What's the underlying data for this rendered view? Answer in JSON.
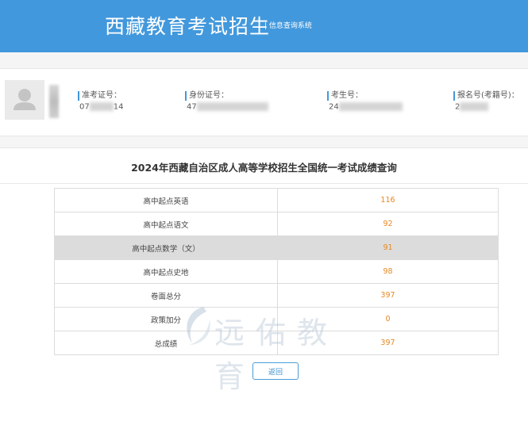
{
  "header": {
    "title": "西藏教育考试招生",
    "subtitle": "| 信息查询系统"
  },
  "candidate": {
    "fields": [
      {
        "label": "准考证号：",
        "value_start": "07",
        "value_end": "14"
      },
      {
        "label": "身份证号：",
        "value_start": "47",
        "value_end": ""
      },
      {
        "label": "考生号：",
        "value_start": "24",
        "value_end": ""
      },
      {
        "label": "报名号(考籍号)：",
        "value_start": "2",
        "value_end": ""
      }
    ]
  },
  "result": {
    "title": "2024年西藏自治区成人高等学校招生全国统一考试成绩查询",
    "rows": [
      {
        "subject": "高中起点英语",
        "score": "116"
      },
      {
        "subject": "高中起点语文",
        "score": "92"
      },
      {
        "subject": "高中起点数学（文）",
        "score": "91"
      },
      {
        "subject": "高中起点史地",
        "score": "98"
      },
      {
        "subject": "卷面总分",
        "score": "397"
      },
      {
        "subject": "政策加分",
        "score": "0"
      },
      {
        "subject": "总成绩",
        "score": "397"
      }
    ],
    "highlighted_row": 2
  },
  "back_button": {
    "label": "返回"
  },
  "watermark": {
    "text": "远佑教育"
  },
  "colors": {
    "header_bg": "#4298dc",
    "score": "#e8871e",
    "highlight_row": "#dcdcdc",
    "accent": "#4298dc"
  }
}
